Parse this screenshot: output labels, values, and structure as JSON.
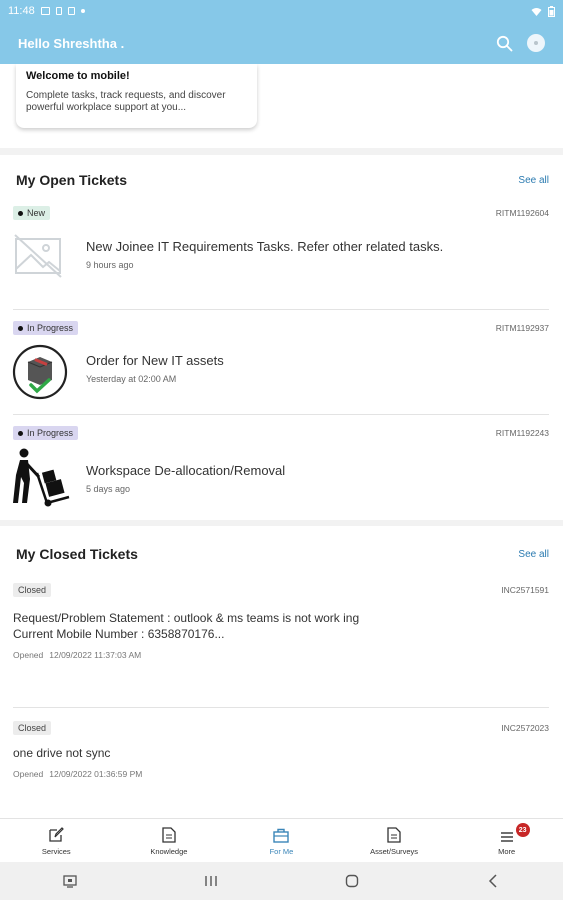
{
  "status_bar": {
    "time": "11:48"
  },
  "header": {
    "greeting": "Hello Shreshtha ."
  },
  "welcome": {
    "title": "Welcome to mobile!",
    "description": "Complete tasks, track requests, and discover powerful workplace support at you..."
  },
  "open_tickets": {
    "title": "My Open Tickets",
    "see_all": "See all",
    "items": [
      {
        "status": "New",
        "number": "RITM1192604",
        "title": "New Joinee IT Requirements Tasks. Refer other related tasks.",
        "time": "9 hours ago",
        "icon": "image-placeholder-icon"
      },
      {
        "status": "In Progress",
        "number": "RITM1192937",
        "title": "Order for New IT assets",
        "time": "Yesterday at 02:00 AM",
        "icon": "package-check-icon"
      },
      {
        "status": "In Progress",
        "number": "RITM1192243",
        "title": "Workspace De-allocation/Removal",
        "time": "5 days ago",
        "icon": "hand-truck-icon"
      }
    ]
  },
  "closed_tickets": {
    "title": "My Closed Tickets",
    "see_all": "See all",
    "items": [
      {
        "status": "Closed",
        "number": "INC2571591",
        "line1": "Request/Problem Statement : outlook & ms teams is not work ing",
        "line2": "Current Mobile Number   : 6358870176...",
        "opened_label": "Opened",
        "opened": "12/09/2022 11:37:03 AM"
      },
      {
        "status": "Closed",
        "number": "INC2572023",
        "line1": "one drive not sync",
        "line2": "",
        "opened_label": "Opened",
        "opened": "12/09/2022 01:36:59 PM"
      }
    ]
  },
  "bottom_nav": {
    "items": [
      {
        "label": "Services",
        "icon": "edit-icon"
      },
      {
        "label": "Knowledge",
        "icon": "document-icon"
      },
      {
        "label": "For Me",
        "icon": "briefcase-icon"
      },
      {
        "label": "Asset/Surveys",
        "icon": "document-icon"
      },
      {
        "label": "More",
        "icon": "menu-icon"
      }
    ],
    "more_badge": "23"
  },
  "colors": {
    "accent": "#86c8e8",
    "link": "#2a7ab0",
    "badge": "#c72727"
  }
}
